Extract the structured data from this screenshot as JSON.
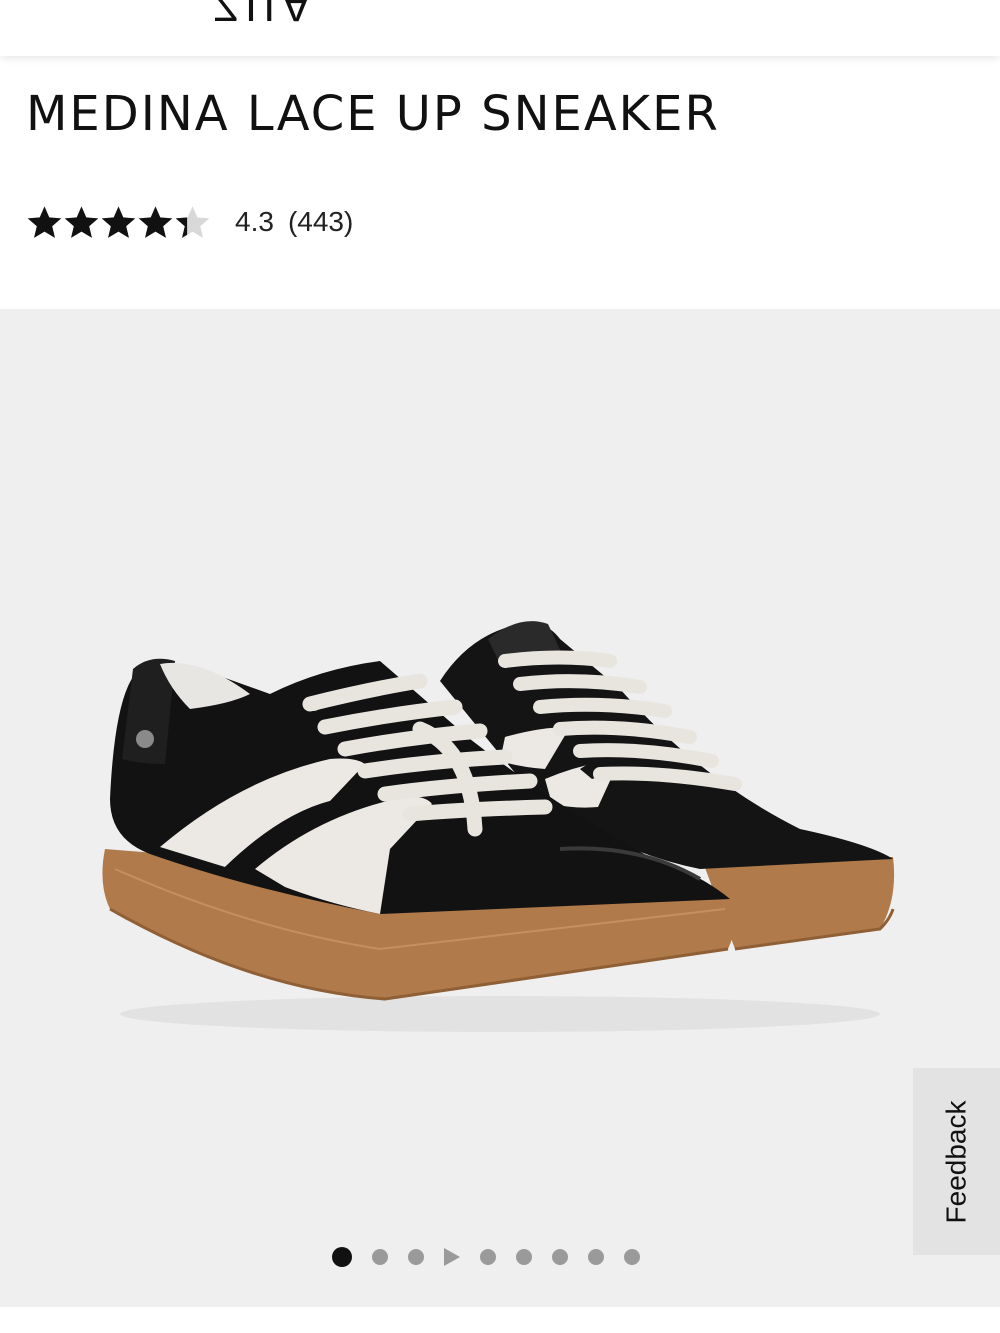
{
  "header": {
    "logo_text": "ZIIA"
  },
  "product": {
    "title": "MEDINA LACE UP SNEAKER",
    "rating_value": "4.3",
    "rating_count": "(443)",
    "rating_stars": 4.3,
    "rating_max": 5
  },
  "gallery": {
    "image_description": "black-leather-sneaker-pair-gum-sole",
    "active_slide": 1,
    "slides_total": 9,
    "video_slide_index": 3
  },
  "feedback": {
    "label": "Feedback"
  },
  "colors": {
    "star_filled": "#111111",
    "star_empty": "#d8d8d8",
    "gallery_bg": "#efefef",
    "sole": "#b07a4a"
  }
}
